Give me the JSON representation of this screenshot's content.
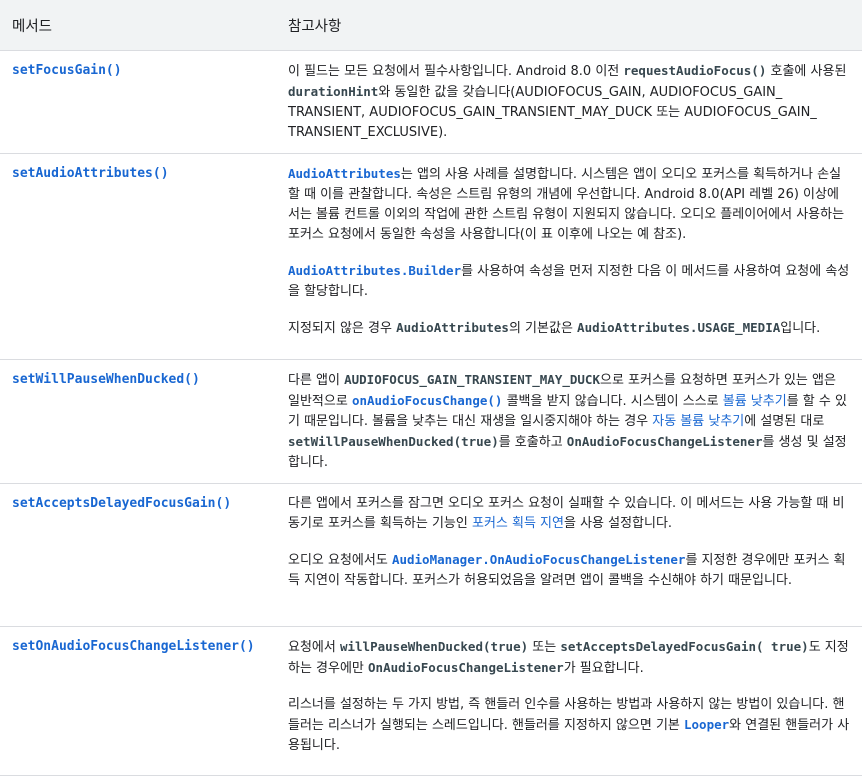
{
  "header": {
    "method": "메서드",
    "notes": "참고사항"
  },
  "rows": [
    {
      "method": "setFocusGain()",
      "notes": [
        [
          {
            "t": "text",
            "v": "이 필드는 모든 요청에서 필수사항입니다. Android 8.0 이전 "
          },
          {
            "t": "code",
            "v": "requestAudioFocus()"
          },
          {
            "t": "text",
            "v": " 호출에 사용된 "
          },
          {
            "t": "code",
            "v": "durationHint"
          },
          {
            "t": "text",
            "v": "와 동일한 값을 갖습니다(AUDIOFOCUS_GAIN, AUDIOFOCUS_GAIN_ TRANSIENT, AUDIOFOCUS_GAIN_TRANSIENT_MAY_DUCK 또는 AUDIOFOCUS_GAIN_ TRANSIENT_EXCLUSIVE)."
          }
        ]
      ]
    },
    {
      "method": "setAudioAttributes()",
      "notes": [
        [
          {
            "t": "codelink",
            "v": "AudioAttributes"
          },
          {
            "t": "text",
            "v": "는 앱의 사용 사례를 설명합니다. 시스템은 앱이 오디오 포커스를 획득하거나 손실할 때 이를 관찰합니다. 속성은 스트림 유형의 개념에 우선합니다. Android 8.0(API 레벨 26) 이상에서는 볼륨 컨트롤 이외의 작업에 관한 스트림 유형이 지원되지 않습니다. 오디오 플레이어에서 사용하는 포커스 요청에서 동일한 속성을 사용합니다(이 표 이후에 나오는 예 참조)."
          }
        ],
        [
          {
            "t": "codelink",
            "v": "AudioAttributes.Builder"
          },
          {
            "t": "text",
            "v": "를 사용하여 속성을 먼저 지정한 다음 이 메서드를 사용하여 요청에 속성을 할당합니다."
          }
        ],
        [
          {
            "t": "text",
            "v": "지정되지 않은 경우 "
          },
          {
            "t": "code",
            "v": "AudioAttributes"
          },
          {
            "t": "text",
            "v": "의 기본값은 "
          },
          {
            "t": "code",
            "v": "AudioAttributes.USAGE_MEDIA"
          },
          {
            "t": "text",
            "v": "입니다."
          }
        ]
      ]
    },
    {
      "method": "setWillPauseWhenDucked()",
      "notes": [
        [
          {
            "t": "text",
            "v": "다른 앱이 "
          },
          {
            "t": "code",
            "v": "AUDIOFOCUS_GAIN_TRANSIENT_MAY_DUCK"
          },
          {
            "t": "text",
            "v": "으로 포커스를 요청하면 포커스가 있는 앱은 일반적으로 "
          },
          {
            "t": "codelink",
            "v": "onAudioFocusChange()"
          },
          {
            "t": "text",
            "v": " 콜백을 받지 않습니다. 시스템이 스스로 "
          },
          {
            "t": "link",
            "v": "볼륨 낮추기"
          },
          {
            "t": "text",
            "v": "를 할 수 있기 때문입니다. 볼륨을 낮추는 대신 재생을 일시중지해야 하는 경우 "
          },
          {
            "t": "link",
            "v": "자동 볼륨 낮추기"
          },
          {
            "t": "text",
            "v": "에 설명된 대로 "
          },
          {
            "t": "code",
            "v": "setWillPauseWhenDucked(true)"
          },
          {
            "t": "text",
            "v": "를 호출하고 "
          },
          {
            "t": "code",
            "v": "OnAudioFocusChangeListener"
          },
          {
            "t": "text",
            "v": "를 생성 및 설정합니다."
          }
        ]
      ]
    },
    {
      "method": "setAcceptsDelayedFocusGain()",
      "notes": [
        [
          {
            "t": "text",
            "v": "다른 앱에서 포커스를 잠그면 오디오 포커스 요청이 실패할 수 있습니다. 이 메서드는 사용 가능할 때 비동기로 포커스를 획득하는 기능인 "
          },
          {
            "t": "link",
            "v": "포커스 획득 지연"
          },
          {
            "t": "text",
            "v": "을 사용 설정합니다."
          }
        ],
        [
          {
            "t": "text",
            "v": "오디오 요청에서도 "
          },
          {
            "t": "codelink",
            "v": "AudioManager.OnAudioFocusChangeListener"
          },
          {
            "t": "text",
            "v": "를 지정한 경우에만 포커스 획득 지연이 작동합니다. 포커스가 허용되었음을 알려면 앱이 콜백을 수신해야 하기 때문입니다."
          }
        ]
      ]
    },
    {
      "method": "setOnAudioFocusChangeListener()",
      "notes": [
        [
          {
            "t": "text",
            "v": "요청에서 "
          },
          {
            "t": "code",
            "v": "willPauseWhenDucked(true)"
          },
          {
            "t": "text",
            "v": " 또는 "
          },
          {
            "t": "code",
            "v": "setAcceptsDelayedFocusGain( true)"
          },
          {
            "t": "text",
            "v": "도 지정하는 경우에만 "
          },
          {
            "t": "code",
            "v": "OnAudioFocusChangeListener"
          },
          {
            "t": "text",
            "v": "가 필요합니다."
          }
        ],
        [
          {
            "t": "text",
            "v": "리스너를 설정하는 두 가지 방법, 즉 핸들러 인수를 사용하는 방법과 사용하지 않는 방법이 있습니다. 핸들러는 리스너가 실행되는 스레드입니다. 핸들러를 지정하지 않으면 기본 "
          },
          {
            "t": "codelink",
            "v": "Looper"
          },
          {
            "t": "text",
            "v": "와 연결된 핸들러가 사용됩니다."
          }
        ]
      ]
    }
  ]
}
